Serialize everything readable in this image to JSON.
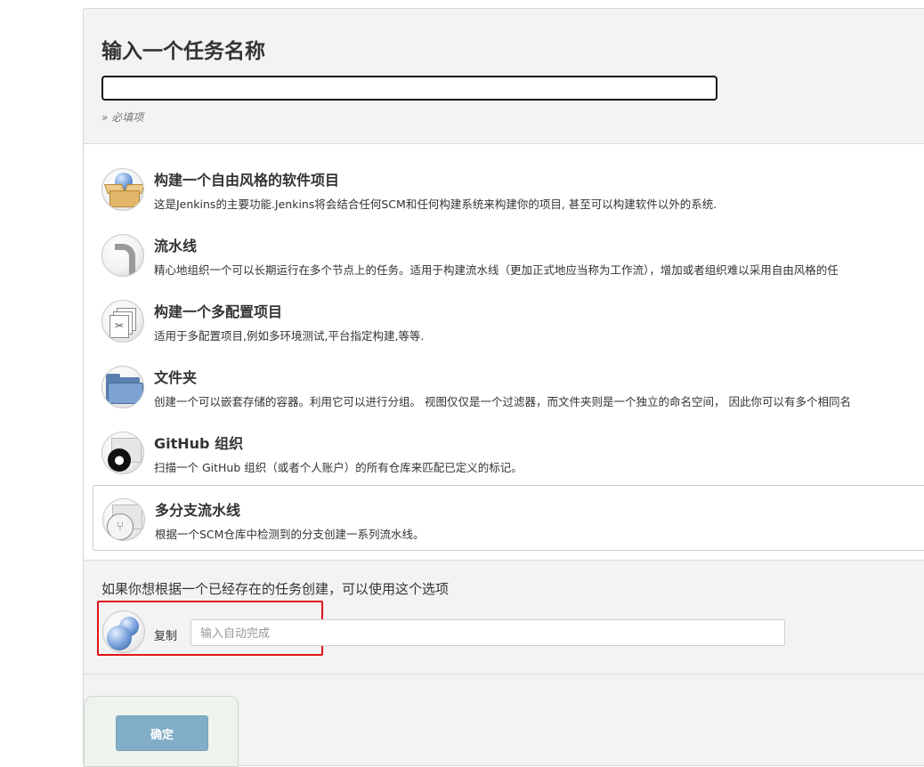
{
  "header": {
    "title": "输入一个任务名称",
    "name_input_value": "",
    "required_note": "» 必填项"
  },
  "items": [
    {
      "label": "构建一个自由风格的软件项目",
      "desc": "这是Jenkins的主要功能.Jenkins将会结合任何SCM和任何构建系统来构建你的项目, 甚至可以构建软件以外的系统.",
      "icon": "freestyle-box-icon"
    },
    {
      "label": "流水线",
      "desc": "精心地组织一个可以长期运行在多个节点上的任务。适用于构建流水线（更加正式地应当称为工作流），增加或者组织难以采用自由风格的任",
      "icon": "pipeline-icon"
    },
    {
      "label": "构建一个多配置项目",
      "desc": "适用于多配置项目,例如多环境测试,平台指定构建,等等.",
      "icon": "multi-config-icon"
    },
    {
      "label": "文件夹",
      "desc": "创建一个可以嵌套存储的容器。利用它可以进行分组。 视图仅仅是一个过滤器，而文件夹则是一个独立的命名空间， 因此你可以有多个相同名",
      "icon": "folder-icon"
    },
    {
      "label": "GitHub 组织",
      "desc": "扫描一个 GitHub 组织（或者个人账户）的所有仓库来匹配已定义的标记。",
      "icon": "github-org-icon"
    },
    {
      "label": "多分支流水线",
      "desc": "根据一个SCM仓库中检测到的分支创建一系列流水线。",
      "icon": "multibranch-icon"
    }
  ],
  "copy": {
    "hint": "如果你想根据一个已经存在的任务创建，可以使用这个选项",
    "label": "复制",
    "placeholder": "输入自动完成",
    "value": ""
  },
  "footer": {
    "ok_label": "确定"
  },
  "colors": {
    "highlight_border": "#e0141a",
    "ok_button_bg": "#81aec6"
  }
}
